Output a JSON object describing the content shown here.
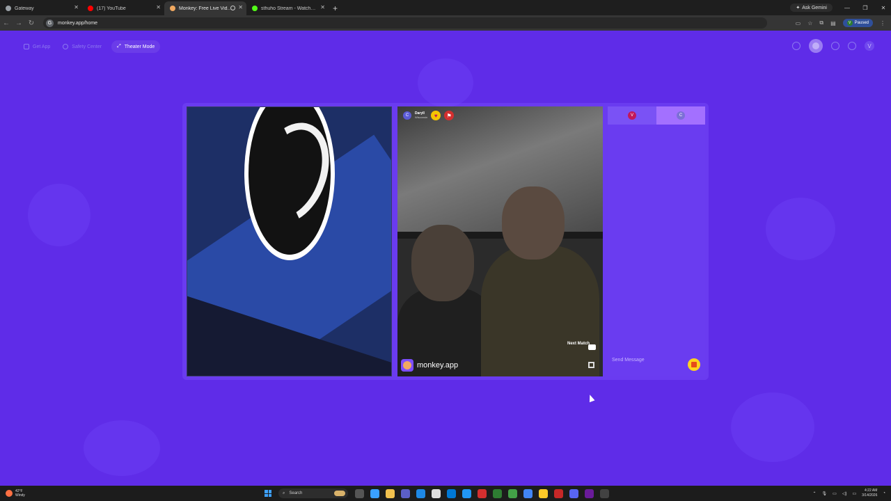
{
  "browser": {
    "tabs": [
      {
        "title": "Gateway",
        "favicon_color": "#9aa0a6",
        "active": false
      },
      {
        "title": "(17) YouTube",
        "favicon_color": "#ff0000",
        "active": false
      },
      {
        "title": "Monkey: Free Live Video Ch",
        "favicon_color": "#f0a860",
        "active": true
      },
      {
        "title": "sthuho Stream - Watch Live on",
        "favicon_color": "#53fc18",
        "active": false
      }
    ],
    "new_tab": "+",
    "ask_gemini": "Ask Gemini",
    "url": "monkey.app/home",
    "profile_initial": "V",
    "profile_status": "Paused"
  },
  "page": {
    "accent": "#5f2ce8",
    "nav": {
      "get_app": "Get App",
      "safety_center": "Safety Center",
      "theater_mode": "Theater Mode"
    },
    "top_right_initial": "V",
    "match": {
      "user_initial": "C",
      "user_name": "Daryll",
      "user_location": "Wisconsin",
      "next_match": "Next Match",
      "brand": "monkey.app"
    },
    "chat": {
      "tab1_initial": "V",
      "tab2_initial": "C",
      "placeholder": "Send Message"
    }
  },
  "taskbar": {
    "weather_temp": "42°F",
    "weather_desc": "Windy",
    "search_label": "Search",
    "time": "4:22 AM",
    "date": "3/14/2026"
  }
}
